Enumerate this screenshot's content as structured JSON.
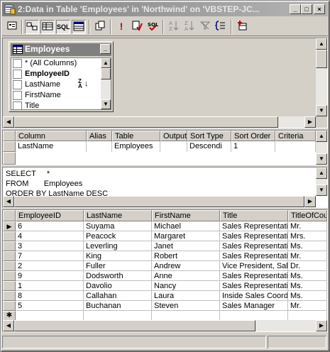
{
  "window": {
    "title": "2:Data in Table 'Employees' in 'Northwind' on 'VBSTEP-JC...",
    "minimize": "_",
    "maximize": "□",
    "close": "×"
  },
  "toolbar": {
    "icons": [
      "properties-icon",
      "diagram-pane-icon",
      "grid-pane-icon",
      "sql-pane-icon",
      "results-pane-icon",
      "change-query-type-icon",
      "run-icon",
      "verify-sql-icon",
      "remove-filter-icon",
      "sort-ascending-icon",
      "sort-descending-icon",
      "remove-filter-icon-2",
      "group-by-icon",
      "add-table-icon"
    ],
    "sql_label": "SQL",
    "run_glyph": "!"
  },
  "diagram": {
    "table_title": "Employees",
    "columns": [
      {
        "label": "* (All Columns)",
        "checked": false,
        "bold": false
      },
      {
        "label": "EmployeeID",
        "checked": false,
        "bold": true
      },
      {
        "label": "LastName",
        "checked": false,
        "bold": false
      },
      {
        "label": "FirstName",
        "checked": false,
        "bold": false
      },
      {
        "label": "Title",
        "checked": false,
        "bold": false
      }
    ],
    "sort_marker_top": "Z",
    "sort_marker_bottom": "A"
  },
  "grid": {
    "headers": [
      "Column",
      "Alias",
      "Table",
      "Output",
      "Sort Type",
      "Sort Order",
      "Criteria"
    ],
    "row": [
      "LastName",
      "",
      "Employees",
      "",
      "Descendi",
      "1",
      ""
    ]
  },
  "sql": {
    "text": "SELECT     *\nFROM       Employees\nORDER BY LastName DESC"
  },
  "results": {
    "headers": [
      "EmployeeID",
      "LastName",
      "FirstName",
      "Title",
      "TitleOfCou"
    ],
    "rows": [
      [
        "6",
        "Suyama",
        "Michael",
        "Sales Representativ",
        "Mr."
      ],
      [
        "4",
        "Peacock",
        "Margaret",
        "Sales Representativ",
        "Mrs."
      ],
      [
        "3",
        "Leverling",
        "Janet",
        "Sales Representativ",
        "Ms."
      ],
      [
        "7",
        "King",
        "Robert",
        "Sales Representativ",
        "Mr."
      ],
      [
        "2",
        "Fuller",
        "Andrew",
        "Vice President, Sale",
        "Dr."
      ],
      [
        "9",
        "Dodsworth",
        "Anne",
        "Sales Representativ",
        "Ms."
      ],
      [
        "1",
        "Davolio",
        "Nancy",
        "Sales Representativ",
        "Ms."
      ],
      [
        "8",
        "Callahan",
        "Laura",
        "Inside Sales Coordi",
        "Ms."
      ],
      [
        "5",
        "Buchanan",
        "Steven",
        "Sales Manager",
        "Mr."
      ]
    ],
    "current_marker": "▶",
    "new_row_marker": "✱"
  }
}
